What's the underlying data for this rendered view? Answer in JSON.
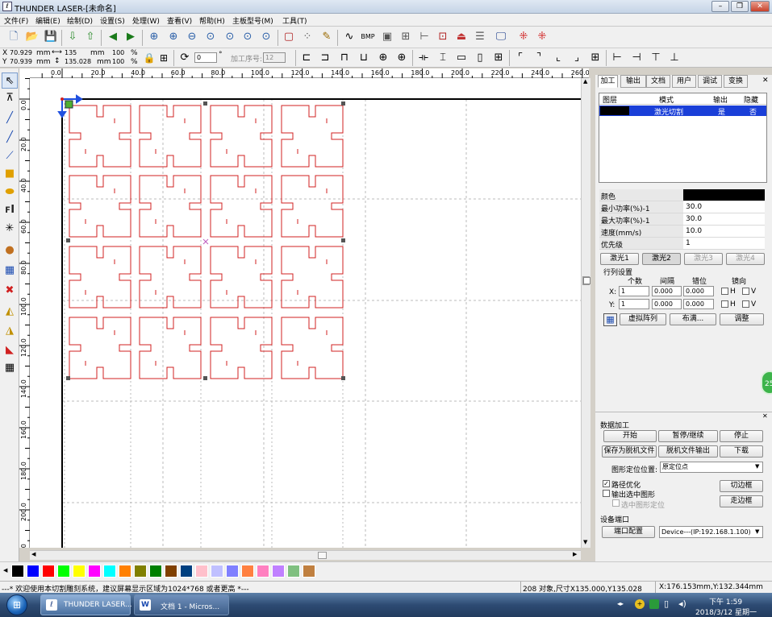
{
  "window": {
    "title": "THUNDER LASER-[未命名]"
  },
  "menu": [
    "文件(F)",
    "编辑(E)",
    "绘制(D)",
    "设置(S)",
    "处理(W)",
    "查看(V)",
    "帮助(H)",
    "主板型号(M)",
    "工具(T)"
  ],
  "toolbar2": {
    "x_label": "X",
    "x_value": "70.929",
    "y_label": "Y",
    "y_value": "70.939",
    "unit": "mm",
    "width_value": "135",
    "height_value": "135.028",
    "scale_x": "100",
    "scale_y": "100",
    "percent": "%",
    "rotate_value": "0",
    "degree": "°",
    "process_no_label": "加工序号:",
    "process_no_value": "12"
  },
  "rulers": {
    "h": [
      "0.0",
      "20.0",
      "40.0",
      "60.0",
      "80.0",
      "100.0",
      "120.0",
      "140.0",
      "160.0",
      "180.0",
      "200.0",
      "220.0",
      "240.0",
      "260.0"
    ],
    "v": [
      "0.0",
      "20.0",
      "40.0",
      "60.0",
      "80.0",
      "100.0",
      "120.0",
      "140.0",
      "160.0",
      "180.0",
      "200.0",
      "220.0"
    ]
  },
  "tabs": [
    "加工",
    "输出",
    "文档",
    "用户",
    "调试",
    "变换"
  ],
  "layers": {
    "headers": [
      "图层",
      "模式",
      "输出",
      "隐藏"
    ],
    "rows": [
      {
        "mode": "激光切割",
        "output": "是",
        "hidden": "否",
        "color": "#000000"
      }
    ]
  },
  "props": [
    {
      "k": "颜色",
      "v": ""
    },
    {
      "k": "最小功率(%)-1",
      "v": "30.0"
    },
    {
      "k": "最大功率(%)-1",
      "v": "30.0"
    },
    {
      "k": "速度(mm/s)",
      "v": "10.0"
    },
    {
      "k": "优先级",
      "v": "1"
    }
  ],
  "laser_tabs": [
    "激光1",
    "激光2",
    "激光3",
    "激光4"
  ],
  "array": {
    "title": "行列设置",
    "headers": [
      "个数",
      "间隔",
      "错位",
      "镜向"
    ],
    "x_label": "X:",
    "y_label": "Y:",
    "x": {
      "count": "1",
      "gap": "0.000",
      "offset": "0.000"
    },
    "y": {
      "count": "1",
      "gap": "0.000",
      "offset": "0.000"
    },
    "h": "H",
    "v": "V",
    "virtual_btn": "虚拟阵列",
    "layout_btn": "布满...",
    "adjust_btn": "调整"
  },
  "data_process": {
    "title": "数据加工",
    "start": "开始",
    "pause": "暂停/继续",
    "stop": "停止",
    "save_offline": "保存为脱机文件",
    "offline_output": "脱机文件输出",
    "download": "下载",
    "position_label": "图形定位位置:",
    "position_value": "原定位点",
    "path_opt": "路径优化",
    "output_selected": "输出选中图形",
    "selected_locate": "选中图形定位",
    "cut_frame": "切边框",
    "walk_frame": "走边框"
  },
  "device": {
    "title": "设备端口",
    "config": "端口配置",
    "value": "Device---(IP:192.168.1.100)"
  },
  "badge": "25",
  "palette": [
    "#000000",
    "#0000ff",
    "#ff0000",
    "#00ff00",
    "#ffff00",
    "#ff00ff",
    "#00ffff",
    "#ff8000",
    "#808000",
    "#008000",
    "#804000",
    "#004080",
    "#ffc0cb",
    "#c0c0ff",
    "#8080ff",
    "#ff8040",
    "#ff80c0",
    "#c080ff",
    "#80c080",
    "#c08040"
  ],
  "status": {
    "left": "---* 欢迎使用本切割雕刻系统，建议屏幕显示区域为1024*768 或者更高 *---",
    "mid": "208 对象,尺寸X135.000,Y135.028",
    "right": "X:176.153mm,Y:132.344mm"
  },
  "taskbar": {
    "app1": "THUNDER LASER...",
    "app2": "文档 1 - Micros...",
    "time": "下午 1:59",
    "date": "2018/3/12 星期一"
  }
}
